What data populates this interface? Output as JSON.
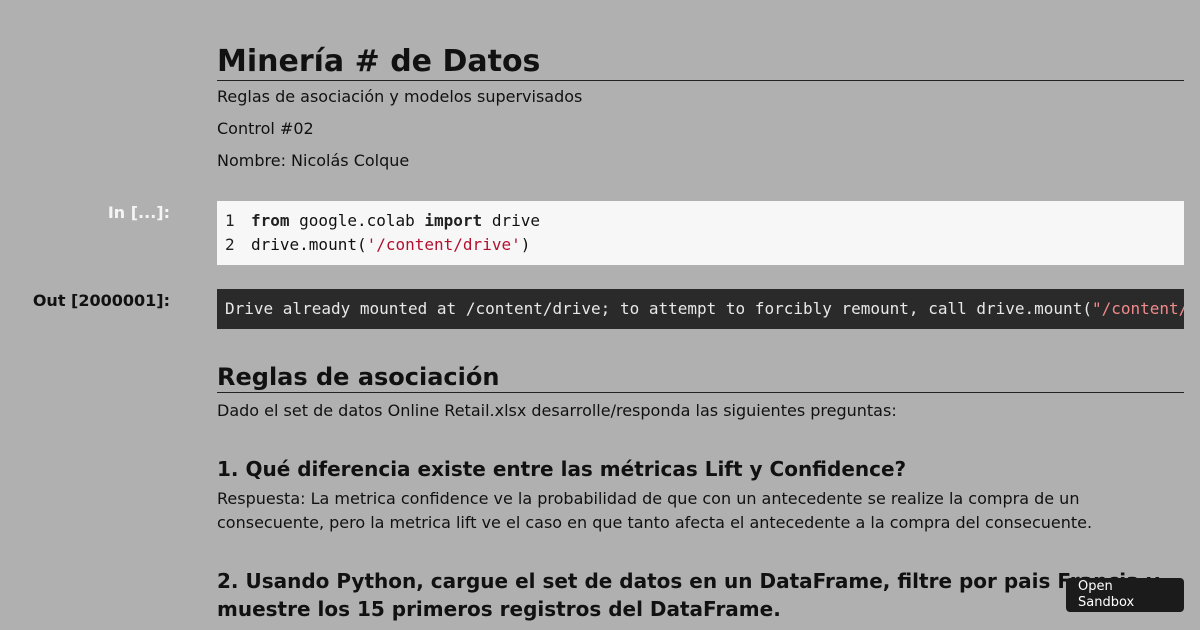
{
  "notebook": {
    "title": "Minería # de Datos",
    "subtitle": "Reglas de asociación y modelos supervisados",
    "control": "Control #02",
    "author": "Nombre: Nicolás Colque"
  },
  "cells": {
    "input_prompt": "In [...]:",
    "code_lines": [
      {
        "num": "1",
        "kw1": "from",
        "mid": " google.colab ",
        "kw2": "import",
        "tail": " drive"
      },
      {
        "num": "2",
        "pre": "drive.mount(",
        "str": "'/content/drive'",
        "post": ")"
      }
    ],
    "output_prompt": "Out [2000001]:",
    "output_text": "Drive already mounted at /content/drive; to attempt to forcibly remount, call drive.mount(",
    "output_str": "\"/content/drive\", force_remount=True)."
  },
  "section": {
    "heading": "Reglas de asociación",
    "intro": "Dado el set de datos Online Retail.xlsx desarrolle/responda las siguientes preguntas:",
    "q1": "1. Qué diferencia existe entre las métricas Lift y Confidence?",
    "a1": "Respuesta: La metrica confidence ve la probabilidad de que con un antecedente se realize la compra de un consecuente, pero la metrica lift ve el caso en que tanto afecta el antecedente a la compra del consecuente.",
    "q2": "2. Usando Python, cargue el set de datos en un DataFrame, filtre por pais Francia y muestre los 15 primeros registros del DataFrame."
  },
  "sandbox": {
    "label": "Open Sandbox"
  },
  "colors": {
    "background": "#b0b0b0",
    "code_bg": "#f7f7f7",
    "output_bg": "#2a2a2a",
    "string_red": "#b2102f",
    "button_bg": "#1b1b1b"
  }
}
